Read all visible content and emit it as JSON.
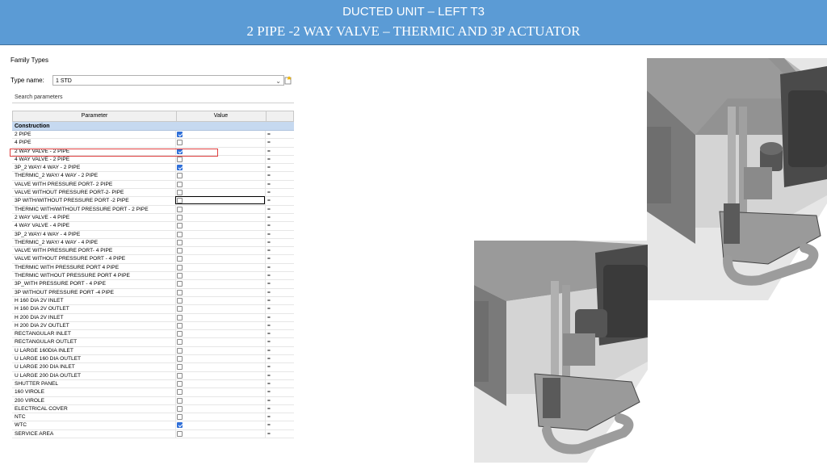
{
  "banner": {
    "line1": "DUCTED UNIT – LEFT T3",
    "line2": "2 PIPE -2 WAY VALVE – THERMIC AND  3P ACTUATOR"
  },
  "family": {
    "title": "Family Types",
    "type_label": "Type name:",
    "type_value": "1 STD",
    "search_placeholder": "Search parameters",
    "col_parameter": "Parameter",
    "col_value": "Value",
    "group": "Construction",
    "eq": "=",
    "rows": [
      {
        "name": "2 PIPE",
        "checked": true
      },
      {
        "name": "4 PIPE",
        "checked": false
      },
      {
        "name": "2 WAY  VALVE - 2 PIPE",
        "checked": true
      },
      {
        "name": "4 WAY VALVE - 2 PIPE",
        "checked": false
      },
      {
        "name": "3P_2 WAY/ 4 WAY - 2 PIPE",
        "checked": true
      },
      {
        "name": "THERMIC_2 WAY/ 4 WAY - 2 PIPE",
        "checked": false
      },
      {
        "name": "VALVE WITH PRESSURE PORT- 2 PIPE",
        "checked": false
      },
      {
        "name": "VALVE WITHOUT PRESSURE PORT-2- PIPE",
        "checked": false
      },
      {
        "name": "3P WITH/WITHOUT PRESSURE PORT -2 PIPE",
        "checked": false
      },
      {
        "name": "THERMIC WITH/WITHOUT PRESSURE PORT - 2 PIPE",
        "checked": false
      },
      {
        "name": "2 WAY VALVE - 4 PIPE",
        "checked": false
      },
      {
        "name": "4 WAY VALVE - 4 PIPE",
        "checked": false
      },
      {
        "name": "3P_2 WAY/ 4 WAY - 4 PIPE",
        "checked": false
      },
      {
        "name": "THERMIC_2 WAY/ 4 WAY - 4 PIPE",
        "checked": false
      },
      {
        "name": "VALVE WITH PRESSURE PORT- 4 PIPE",
        "checked": false
      },
      {
        "name": "VALVE WITHOUT PRESSURE PORT - 4 PIPE",
        "checked": false
      },
      {
        "name": "THERMIC WITH PRESSURE PORT 4 PIPE",
        "checked": false
      },
      {
        "name": "THERMIC WITHOUT PRESSURE PORT  4 PIPE",
        "checked": false
      },
      {
        "name": "3P_WITH PRESSURE PORT - 4 PIPE",
        "checked": false
      },
      {
        "name": "3P WITHOUT PRESSURE PORT -4  PIPE",
        "checked": false
      },
      {
        "name": "H 160 DIA 2V INLET",
        "checked": false
      },
      {
        "name": "H 160 DIA 2V OUTLET",
        "checked": false
      },
      {
        "name": "H 200 DIA 2V INLET",
        "checked": false
      },
      {
        "name": "H 200 DIA 2V OUTLET",
        "checked": false
      },
      {
        "name": "RECTANGULAR INLET",
        "checked": false
      },
      {
        "name": "RECTANGULAR  OUTLET",
        "checked": false
      },
      {
        "name": "U LARGE 160DIA INLET",
        "checked": false
      },
      {
        "name": "U LARGE 160 DIA OUTLET",
        "checked": false
      },
      {
        "name": "U LARGE 200 DIA INLET",
        "checked": false
      },
      {
        "name": "U LARGE 200 DIA OUTLET",
        "checked": false
      },
      {
        "name": "SHUTTER PANEL",
        "checked": false
      },
      {
        "name": "160 VIROLE",
        "checked": false
      },
      {
        "name": "200 VIROLE",
        "checked": false
      },
      {
        "name": "ELECTRICAL COVER",
        "checked": false
      },
      {
        "name": "NTC",
        "checked": false
      },
      {
        "name": "WTC",
        "checked": true
      },
      {
        "name": "SERVICE AREA",
        "checked": false
      }
    ]
  }
}
